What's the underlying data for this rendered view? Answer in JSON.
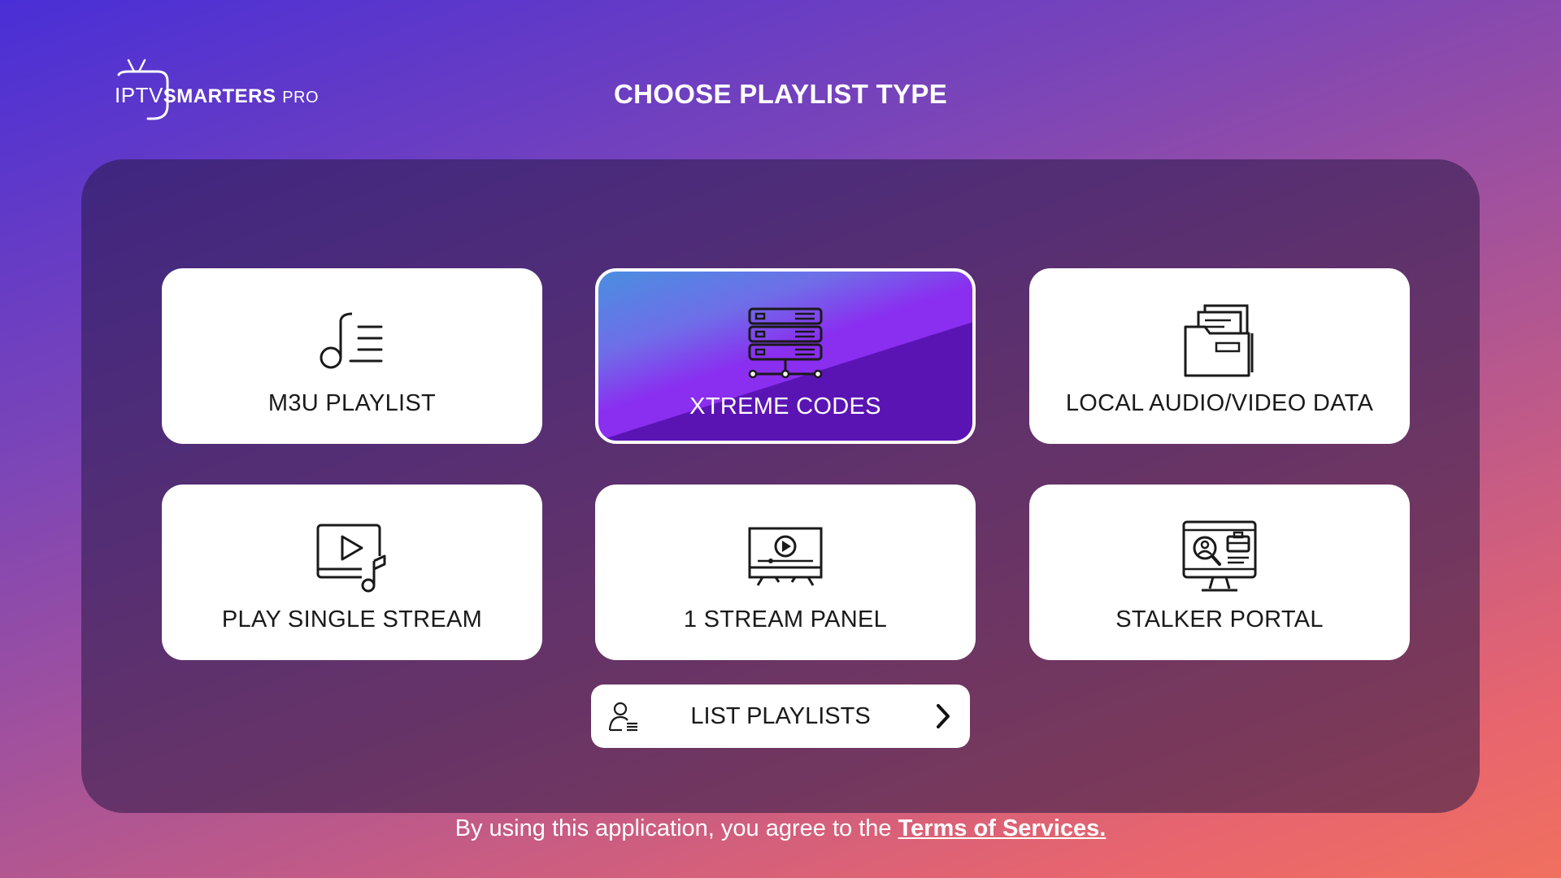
{
  "logo": {
    "part1": "IPTV",
    "part2": "SMARTERS",
    "part3": "PRO"
  },
  "header": {
    "title": "CHOOSE PLAYLIST TYPE"
  },
  "cards": [
    {
      "label": "M3U PLAYLIST",
      "icon": "music-playlist-icon",
      "selected": false
    },
    {
      "label": "XTREME CODES",
      "icon": "server-network-icon",
      "selected": true
    },
    {
      "label": "LOCAL AUDIO/VIDEO DATA",
      "icon": "folder-files-icon",
      "selected": false
    },
    {
      "label": "PLAY SINGLE STREAM",
      "icon": "video-music-icon",
      "selected": false
    },
    {
      "label": "1 STREAM PANEL",
      "icon": "tv-play-icon",
      "selected": false
    },
    {
      "label": "STALKER PORTAL",
      "icon": "monitor-user-search-icon",
      "selected": false
    }
  ],
  "list_button": {
    "label": "LIST PLAYLISTS",
    "icon": "user-list-icon",
    "arrow": "chevron-right-icon"
  },
  "footer": {
    "text": "By using this application, you agree to the ",
    "link": "Terms of Services."
  },
  "colors": {
    "selected_top": "#4a8ee0",
    "selected_bottom": "#8a2ef0",
    "background_start": "#4a2fd6",
    "background_end": "#f0705f"
  }
}
